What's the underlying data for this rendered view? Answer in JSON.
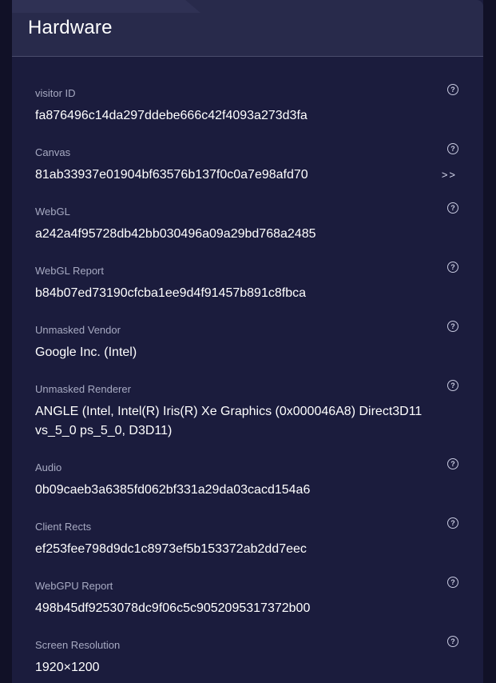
{
  "header": {
    "title": "Hardware"
  },
  "rows": [
    {
      "label": "visitor ID",
      "value": "fa876496c14da297ddebe666c42f4093a273d3fa",
      "help_icon": "question-circle-icon"
    },
    {
      "label": "Canvas",
      "value": "81ab33937e01904bf63576b137f0c0a7e98afd70",
      "help_icon": "question-circle-icon",
      "more_label": ">>"
    },
    {
      "label": "WebGL",
      "value": "a242a4f95728db42bb030496a09a29bd768a2485",
      "help_icon": "question-circle-icon"
    },
    {
      "label": "WebGL Report",
      "value": "b84b07ed73190cfcba1ee9d4f91457b891c8fbca",
      "help_icon": "question-circle-icon"
    },
    {
      "label": "Unmasked Vendor",
      "value": "Google Inc. (Intel)",
      "help_icon": "question-circle-icon"
    },
    {
      "label": "Unmasked Renderer",
      "value": "ANGLE (Intel, Intel(R) Iris(R) Xe Graphics (0x000046A8) Direct3D11 vs_5_0 ps_5_0, D3D11)",
      "help_icon": "question-circle-icon"
    },
    {
      "label": "Audio",
      "value": "0b09caeb3a6385fd062bf331a29da03cacd154a6",
      "help_icon": "question-circle-icon"
    },
    {
      "label": "Client Rects",
      "value": "ef253fee798d9dc1c8973ef5b153372ab2dd7eec",
      "help_icon": "question-circle-icon"
    },
    {
      "label": "WebGPU Report",
      "value": "498b45df9253078dc9f06c5c9052095317372b00",
      "help_icon": "question-circle-icon"
    },
    {
      "label": "Screen Resolution",
      "value": "1920×1200",
      "help_icon": "question-circle-icon"
    }
  ],
  "colors": {
    "background": "#111127",
    "panel": "#1b1c3d",
    "header": "#282a4b",
    "label": "#a7aac2",
    "value": "#ffffff"
  }
}
